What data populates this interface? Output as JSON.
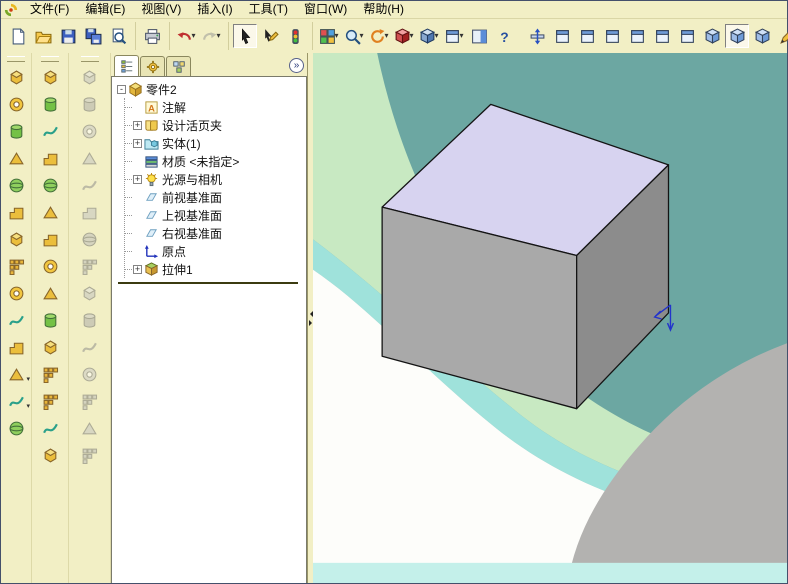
{
  "colors": {
    "ui_bg": "#F2EFC5",
    "viewport_teal": "#6CA7A2",
    "viewport_green": "#C8E9C2",
    "viewport_cyan": "#9FE2DB",
    "viewport_white": "#FDFDFA",
    "viewport_gray": "#B3B2B0",
    "viewport_bottom_strip": "#C4F0EA",
    "cube_top": "#D7D3F0",
    "cube_front": "#A9A9A9",
    "cube_side": "#8C8C8C",
    "cube_edge": "#141414",
    "origin_marker": "#2233CC"
  },
  "menu_bar": {
    "items": [
      {
        "name": "menu-file",
        "label": "文件(F)"
      },
      {
        "name": "menu-edit",
        "label": "编辑(E)"
      },
      {
        "name": "menu-view",
        "label": "视图(V)"
      },
      {
        "name": "menu-insert",
        "label": "插入(I)"
      },
      {
        "name": "menu-tools",
        "label": "工具(T)"
      },
      {
        "name": "menu-window",
        "label": "窗口(W)"
      },
      {
        "name": "menu-help",
        "label": "帮助(H)"
      }
    ]
  },
  "toolbar": {
    "file_group": [
      {
        "name": "new-document-button",
        "symbol": "sym-doc"
      },
      {
        "name": "open-document-button",
        "symbol": "sym-folder"
      },
      {
        "name": "save-button",
        "symbol": "sym-floppy"
      },
      {
        "name": "save-all-button",
        "symbol": "sym-floppy-multi"
      },
      {
        "name": "print-preview-button",
        "symbol": "sym-preview"
      }
    ],
    "print_group": [
      {
        "name": "print-button",
        "symbol": "sym-printer"
      }
    ],
    "undo_group": [
      {
        "name": "undo-button",
        "symbol": "sym-undo",
        "dropdown": "▾"
      },
      {
        "name": "redo-button",
        "symbol": "sym-redo",
        "dropdown": "▾",
        "state": "disabled"
      }
    ],
    "select_group": [
      {
        "name": "select-button",
        "symbol": "sym-cursor",
        "state": "pressed"
      },
      {
        "name": "select-other-button",
        "symbol": "sym-cursor-pen"
      },
      {
        "name": "selection-filter-button",
        "symbol": "sym-filter"
      }
    ],
    "view_tools_group": [
      {
        "name": "sketch-toggle-button",
        "symbol": "sym-grid",
        "dropdown": "▾"
      },
      {
        "name": "zoom-tools-button",
        "symbol": "sym-zoom",
        "dropdown": "▾"
      },
      {
        "name": "rotate-view-button",
        "symbol": "sym-rotate",
        "dropdown": "▾"
      },
      {
        "name": "section-view-button",
        "symbol": "sym-cube-red",
        "dropdown": "▾"
      },
      {
        "name": "display-style-button",
        "symbol": "sym-cube-blue",
        "dropdown": "▾"
      },
      {
        "name": "view-orientation-button",
        "symbol": "sym-view-cube",
        "dropdown": "▾"
      },
      {
        "name": "task-pane-button",
        "symbol": "sym-panel"
      },
      {
        "name": "help-button",
        "symbol": "sym-help"
      }
    ],
    "standard_views_group": [
      {
        "name": "normal-to-view-button",
        "symbol": "sym-normal"
      },
      {
        "name": "front-view-button",
        "symbol": "sym-view-cube"
      },
      {
        "name": "back-view-button",
        "symbol": "sym-view-cube"
      },
      {
        "name": "left-view-button",
        "symbol": "sym-view-cube"
      },
      {
        "name": "right-view-button",
        "symbol": "sym-view-cube"
      },
      {
        "name": "top-view-button",
        "symbol": "sym-view-cube"
      },
      {
        "name": "bottom-view-button",
        "symbol": "sym-view-cube"
      },
      {
        "name": "isometric-view-button",
        "symbol": "sym-iso-cube"
      },
      {
        "name": "trimetric-view-button",
        "symbol": "sym-iso-cube",
        "state": "pressed"
      },
      {
        "name": "dimetric-view-button",
        "symbol": "sym-iso-cube"
      },
      {
        "name": "edit-sketch-button",
        "symbol": "sym-pencil"
      }
    ]
  },
  "left_toolbars": {
    "toolbar_a": [
      {
        "name": "left-tool-1-button",
        "symbol": "sym-f-box"
      },
      {
        "name": "left-tool-2-button",
        "symbol": "sym-f-ring"
      },
      {
        "name": "left-tool-3-button",
        "symbol": "sym-f-cyl"
      },
      {
        "name": "left-tool-4-button",
        "symbol": "sym-f-wedge"
      },
      {
        "name": "left-tool-5-button",
        "symbol": "sym-f-sphere"
      },
      {
        "name": "left-tool-6-button",
        "symbol": "sym-f-step"
      },
      {
        "name": "left-tool-7-button",
        "symbol": "sym-f-box"
      },
      {
        "name": "left-tool-8-button",
        "symbol": "sym-f-pattern"
      },
      {
        "name": "left-tool-9-button",
        "symbol": "sym-f-ring"
      },
      {
        "name": "left-tool-10-button",
        "symbol": "sym-f-squiggle"
      },
      {
        "name": "left-tool-11-button",
        "symbol": "sym-f-step"
      },
      {
        "name": "left-tool-12-button",
        "symbol": "sym-f-wedge",
        "dropdown": "▾"
      },
      {
        "name": "left-tool-13-button",
        "symbol": "sym-f-squiggle",
        "dropdown": "▾"
      },
      {
        "name": "left-tool-14-button",
        "symbol": "sym-f-sphere"
      }
    ],
    "features_toolbar": [
      {
        "name": "extrude-boss-button",
        "symbol": "sym-f-box"
      },
      {
        "name": "revolve-boss-button",
        "symbol": "sym-f-cyl"
      },
      {
        "name": "sweep-button",
        "symbol": "sym-f-squiggle"
      },
      {
        "name": "loft-button",
        "symbol": "sym-f-step"
      },
      {
        "name": "fillet-button",
        "symbol": "sym-f-sphere"
      },
      {
        "name": "chamfer-button",
        "symbol": "sym-f-wedge"
      },
      {
        "name": "rib-button",
        "symbol": "sym-f-step"
      },
      {
        "name": "shell-button",
        "symbol": "sym-f-ring"
      },
      {
        "name": "draft-button",
        "symbol": "sym-f-wedge"
      },
      {
        "name": "hole-wizard-button",
        "symbol": "sym-f-cyl"
      },
      {
        "name": "mirror-feature-button",
        "symbol": "sym-f-box"
      },
      {
        "name": "linear-pattern-button",
        "symbol": "sym-f-pattern"
      },
      {
        "name": "circular-pattern-button",
        "symbol": "sym-f-pattern"
      },
      {
        "name": "curve-button",
        "symbol": "sym-f-squiggle"
      },
      {
        "name": "reference-geometry-button",
        "symbol": "sym-f-box"
      }
    ],
    "sketch_toolbar": [
      {
        "name": "sketch-tool-1-button",
        "symbol": "sym-f-box",
        "state": "disabled"
      },
      {
        "name": "sketch-tool-2-button",
        "symbol": "sym-f-cyl",
        "state": "disabled"
      },
      {
        "name": "sketch-tool-3-button",
        "symbol": "sym-f-ring",
        "state": "disabled"
      },
      {
        "name": "sketch-tool-4-button",
        "symbol": "sym-f-wedge",
        "state": "disabled"
      },
      {
        "name": "sketch-tool-5-button",
        "symbol": "sym-f-squiggle",
        "state": "disabled"
      },
      {
        "name": "sketch-tool-6-button",
        "symbol": "sym-f-step",
        "state": "disabled"
      },
      {
        "name": "sketch-tool-7-button",
        "symbol": "sym-f-sphere",
        "state": "disabled"
      },
      {
        "name": "sketch-tool-8-button",
        "symbol": "sym-f-pattern",
        "state": "disabled"
      },
      {
        "name": "sketch-tool-9-button",
        "symbol": "sym-f-box",
        "state": "disabled"
      },
      {
        "name": "sketch-tool-10-button",
        "symbol": "sym-f-cyl",
        "state": "disabled"
      },
      {
        "name": "sketch-tool-11-button",
        "symbol": "sym-f-squiggle",
        "state": "disabled"
      },
      {
        "name": "sketch-tool-12-button",
        "symbol": "sym-f-ring",
        "state": "disabled"
      },
      {
        "name": "sketch-tool-13-button",
        "symbol": "sym-f-pattern",
        "state": "disabled"
      },
      {
        "name": "sketch-tool-14-button",
        "symbol": "sym-f-wedge",
        "state": "disabled"
      },
      {
        "name": "sketch-tool-15-button",
        "symbol": "sym-f-pattern",
        "state": "disabled"
      }
    ]
  },
  "feature_panel": {
    "tabs": [
      {
        "name": "featuremanager-tab",
        "symbol": "sym-tab-fm",
        "state": "active"
      },
      {
        "name": "propertymanager-tab",
        "symbol": "sym-tab-pm"
      },
      {
        "name": "configurationmanager-tab",
        "symbol": "sym-tab-cm"
      }
    ],
    "collapse_button_glyph": "»",
    "tree": {
      "root": {
        "name": "tree-item-part",
        "label": "零件2",
        "icon": "sym-part",
        "expander": "-"
      },
      "items": [
        {
          "name": "tree-item-annotations",
          "label": "注解",
          "icon": "sym-annot"
        },
        {
          "name": "tree-item-design-binder",
          "label": "设计活页夹",
          "icon": "sym-binder",
          "expander": "+"
        },
        {
          "name": "tree-item-solid-bodies",
          "label": "实体(1)",
          "icon": "sym-solidfolder",
          "expander": "+"
        },
        {
          "name": "tree-item-material",
          "label": "材质 <未指定>",
          "icon": "sym-material"
        },
        {
          "name": "tree-item-lights-cameras",
          "label": "光源与相机",
          "icon": "sym-light",
          "expander": "+"
        },
        {
          "name": "tree-item-front-plane",
          "label": "前视基准面",
          "icon": "sym-plane"
        },
        {
          "name": "tree-item-top-plane",
          "label": "上视基准面",
          "icon": "sym-plane"
        },
        {
          "name": "tree-item-right-plane",
          "label": "右视基准面",
          "icon": "sym-plane"
        },
        {
          "name": "tree-item-origin",
          "label": "原点",
          "icon": "sym-origin"
        },
        {
          "name": "tree-item-extrude1",
          "label": "拉伸1",
          "icon": "sym-extrude",
          "expander": "+"
        }
      ]
    }
  }
}
